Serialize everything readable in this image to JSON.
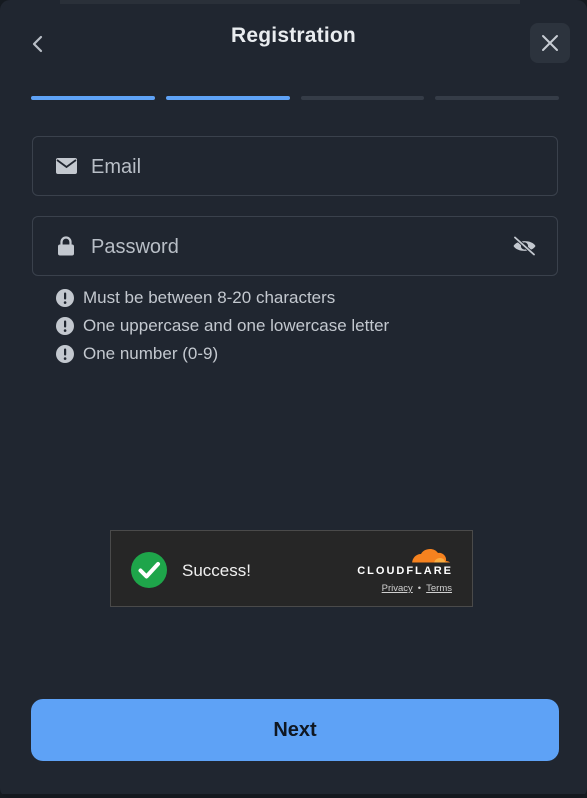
{
  "header": {
    "title": "Registration",
    "back_icon": "chevron-left-icon",
    "close_icon": "close-icon"
  },
  "progress": {
    "total_steps": 4,
    "completed_steps": 2,
    "active_color": "#5ea2f6",
    "inactive_color": "#353c47"
  },
  "form": {
    "email": {
      "placeholder": "Email",
      "value": "",
      "icon": "envelope-icon"
    },
    "password": {
      "placeholder": "Password",
      "value": "",
      "icon": "lock-icon",
      "toggle_icon": "eye-off-icon"
    }
  },
  "password_rules": [
    {
      "text": "Must be between 8-20 characters",
      "icon": "exclamation-circle-icon"
    },
    {
      "text": "One uppercase and one lowercase letter",
      "icon": "exclamation-circle-icon"
    },
    {
      "text": "One number (0-9)",
      "icon": "exclamation-circle-icon"
    }
  ],
  "captcha": {
    "status": "Success!",
    "brand": "CLOUDFLARE",
    "privacy_link": "Privacy",
    "separator": "•",
    "terms_link": "Terms",
    "success_color": "#1ea54a",
    "brand_color": "#f6821f"
  },
  "footer": {
    "next_label": "Next"
  },
  "colors": {
    "accent": "#5ea2f6",
    "modal_bg": "#202630"
  }
}
